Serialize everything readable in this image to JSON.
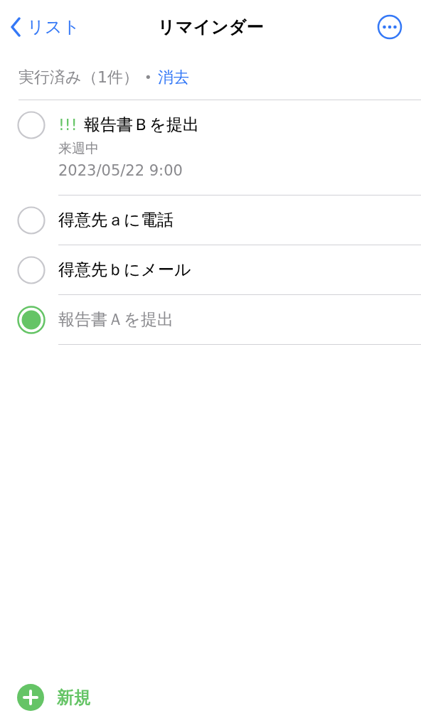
{
  "nav": {
    "back_label": "リスト",
    "title": "リマインダー"
  },
  "completed_bar": {
    "label": "実行済み（1件）",
    "separator": "•",
    "action": "消去"
  },
  "reminders": [
    {
      "priority": "!!!",
      "title": "報告書Ｂを提出",
      "notes": "来週中",
      "date": "2023/05/22 9:00",
      "completed": false
    },
    {
      "title": "得意先ａに電話",
      "completed": false
    },
    {
      "title": "得意先ｂにメール",
      "completed": false
    },
    {
      "title": "報告書Ａを提出",
      "completed": true
    }
  ],
  "new_button": {
    "label": "新規"
  }
}
